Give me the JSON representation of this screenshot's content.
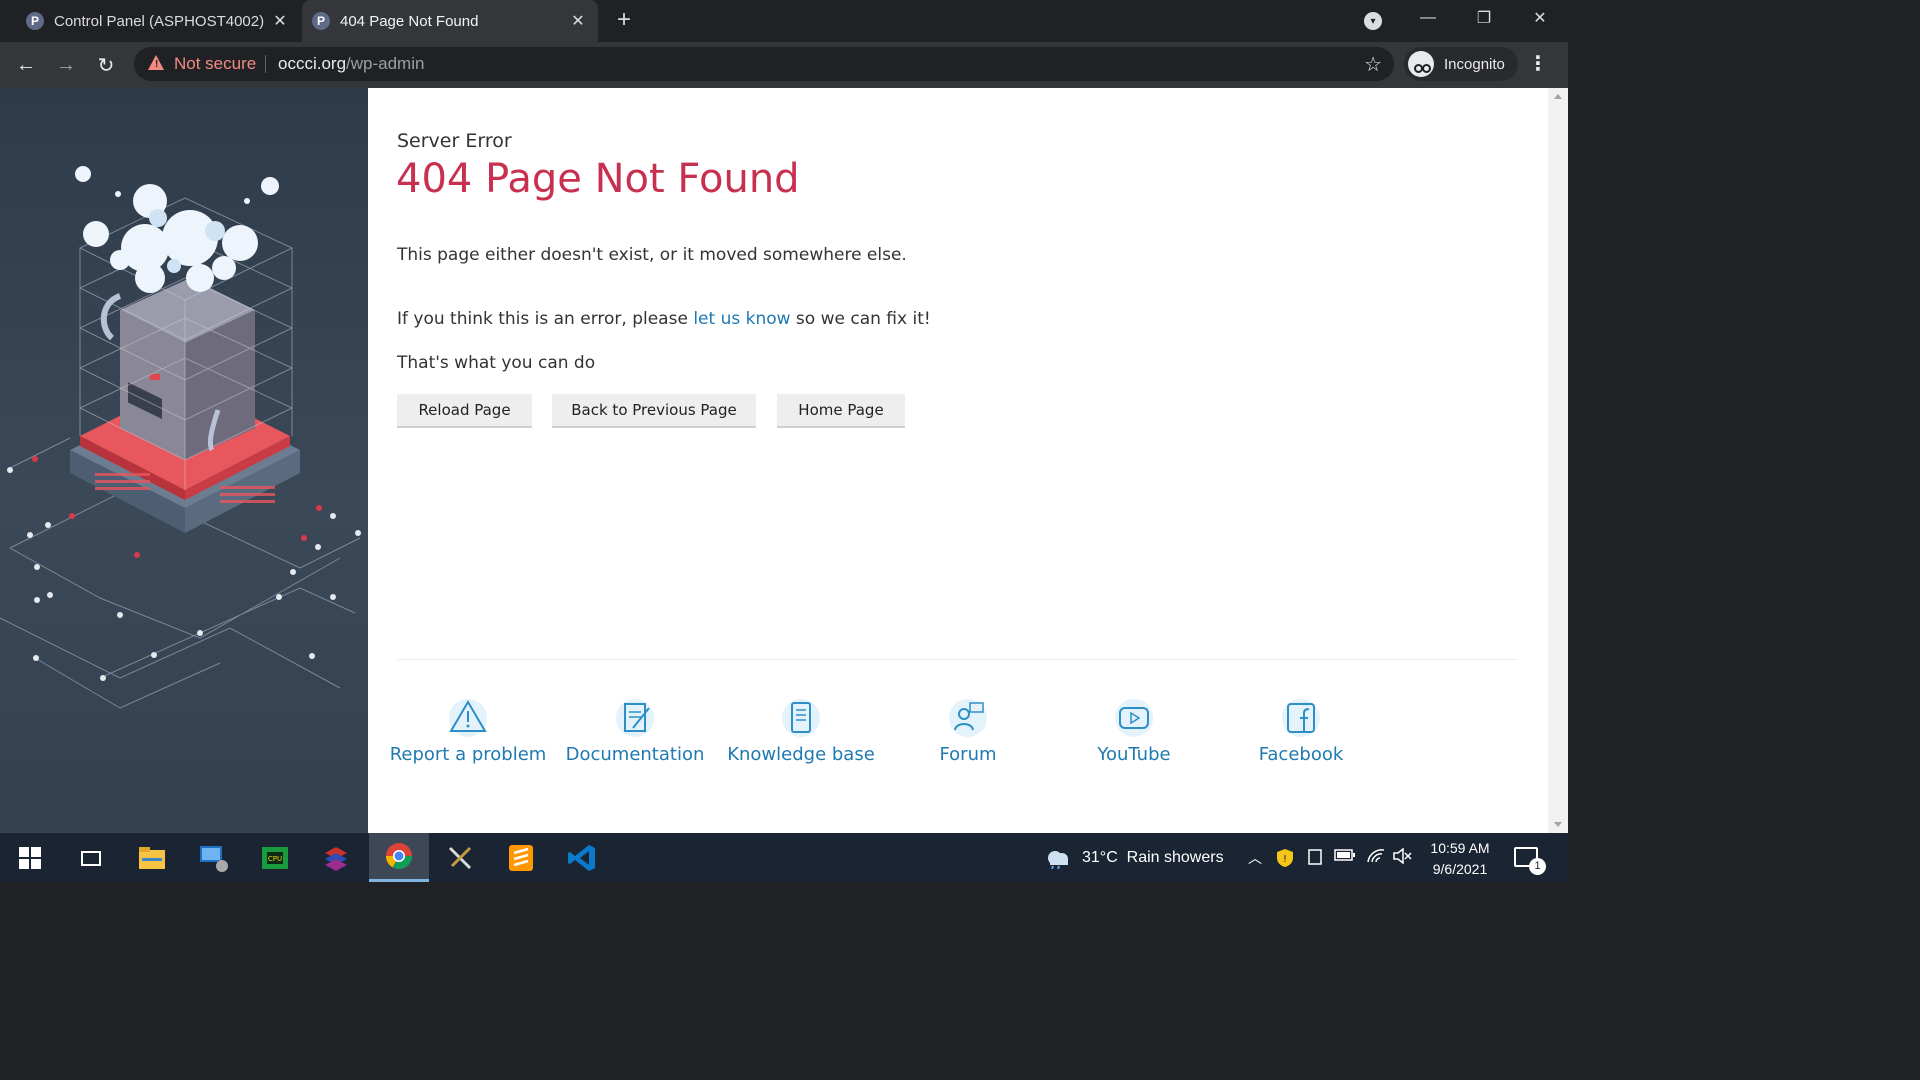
{
  "tabs": [
    {
      "favicon": "P",
      "title": "Control Panel (ASPHOST4002)",
      "close": "✕"
    },
    {
      "favicon": "P",
      "title": "404 Page Not Found",
      "close": "✕"
    }
  ],
  "new_tab": "+",
  "window_controls": {
    "minimize": "—",
    "restore": "❐",
    "close": "✕"
  },
  "toolbar": {
    "back": "←",
    "forward": "→",
    "reload": "↻",
    "security_label": "Not secure",
    "url_host": "occci.org",
    "url_path": "/wp-admin",
    "bookmark_star": "☆",
    "incognito_label": "Incognito",
    "menu": "⋮"
  },
  "page": {
    "eyebrow": "Server Error",
    "title": "404 Page Not Found",
    "message": "This page either doesn't exist, or it moved somewhere else.",
    "error_prefix": "If you think this is an error, please ",
    "error_link": "let us know",
    "error_suffix": " so we can fix it!",
    "actions_heading": "That's what you can do",
    "buttons": {
      "reload": "Reload Page",
      "back": "Back to Previous Page",
      "home": "Home Page"
    },
    "footer_links": [
      {
        "label": "Report a problem",
        "icon": "warning-icon"
      },
      {
        "label": "Documentation",
        "icon": "document-edit-icon"
      },
      {
        "label": "Knowledge base",
        "icon": "book-icon"
      },
      {
        "label": "Forum",
        "icon": "forum-users-icon"
      },
      {
        "label": "YouTube",
        "icon": "youtube-play-icon"
      },
      {
        "label": "Facebook",
        "icon": "facebook-icon"
      }
    ]
  },
  "taskbar": {
    "apps": [
      "start",
      "task-view",
      "file-explorer",
      "remote-desktop",
      "cpu-z",
      "layers-app",
      "chrome",
      "tools-app",
      "sublime-text",
      "vscode"
    ],
    "weather_temp": "31°C",
    "weather_text": "Rain showers",
    "time": "10:59 AM",
    "date": "9/6/2021",
    "notification_count": "1"
  },
  "colors": {
    "error_title": "#c7304f",
    "link": "#1e7ab0",
    "security_warning": "#f28b82"
  }
}
